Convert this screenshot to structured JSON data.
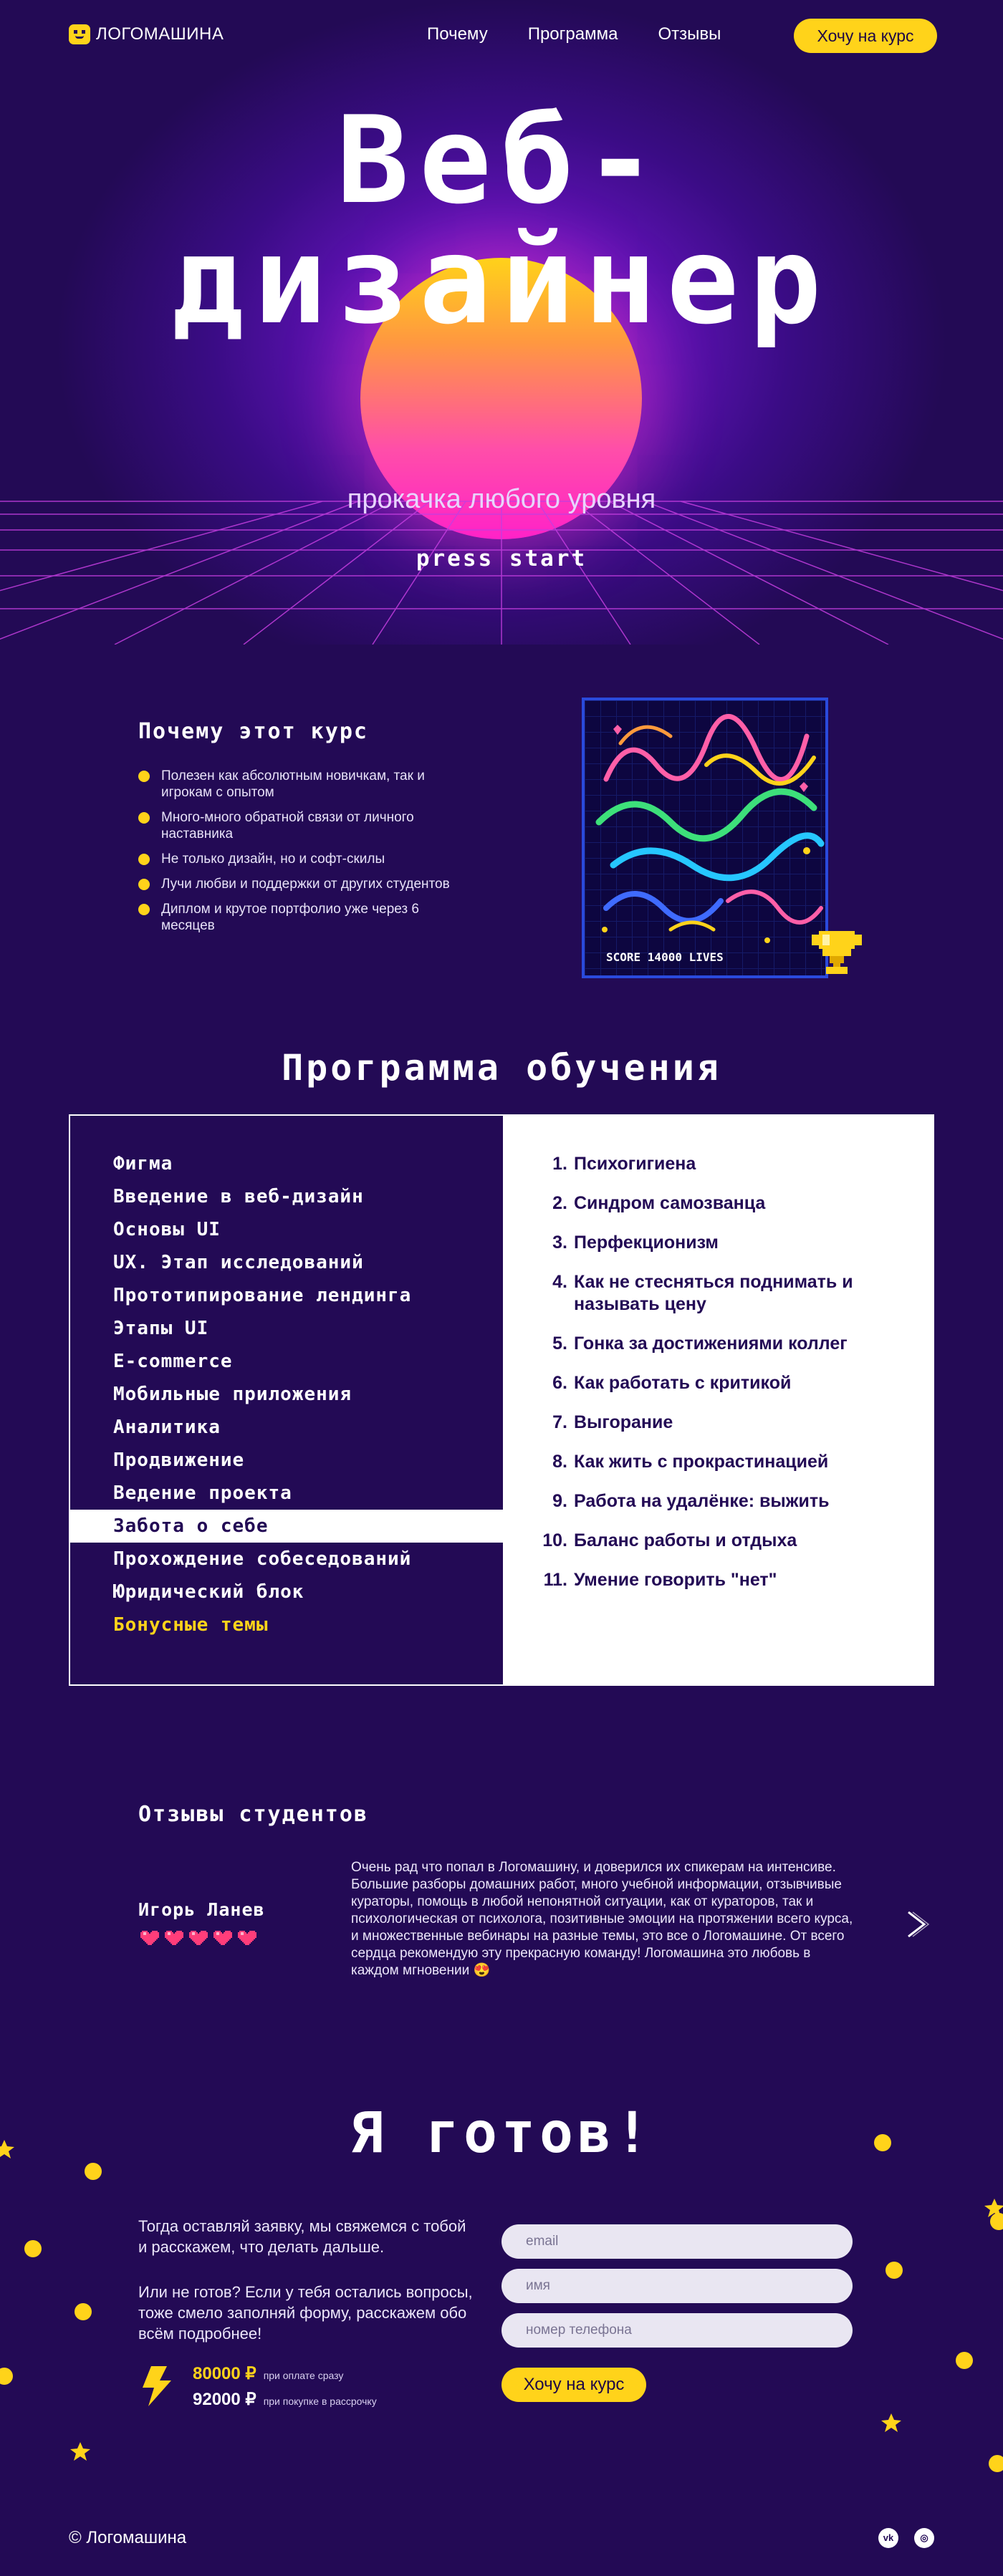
{
  "header": {
    "logo": "ЛОГОМАШИНА",
    "nav": [
      "Почему",
      "Программа",
      "Отзывы"
    ],
    "cta": "Хочу на курс"
  },
  "hero": {
    "title_line1": "Веб-",
    "title_line2": "дизайнер",
    "subtitle": "прокачка любого уровня",
    "press_start": "press start"
  },
  "why": {
    "title": "Почему этот курс",
    "items": [
      "Полезен как абсолютным новичкам, так и игрокам с опытом",
      "Много-много обратной связи от личного наставника",
      "Не только дизайн, но и софт-скилы",
      "Лучи любви и поддержки от других студентов",
      "Диплом и крутое портфолио уже через 6 месяцев"
    ],
    "poster_score": "SCORE 14000  LIVES"
  },
  "program": {
    "title": "Программа обучения",
    "modules": [
      "Фигма",
      "Введение в веб-дизайн",
      "Основы UI",
      "UX. Этап исследований",
      "Прототипирование лендинга",
      "Этапы UI",
      "E-commerce",
      "Мобильные приложения",
      "Аналитика",
      "Продвижение",
      "Ведение проекта",
      "Забота о себе",
      "Прохождение собеседований",
      "Юридический блок",
      "Бонусные темы"
    ],
    "active_module_index": 11,
    "topics": [
      {
        "num": "1.",
        "text": "Психогигиена"
      },
      {
        "num": "2.",
        "text": "Синдром самозванца"
      },
      {
        "num": "3.",
        "text": "Перфекционизм"
      },
      {
        "num": "4.",
        "text": "Как не стесняться поднимать и называть цену"
      },
      {
        "num": "5.",
        "text": "Гонка за достижениями коллег"
      },
      {
        "num": "6.",
        "text": "Как работать с критикой"
      },
      {
        "num": "7.",
        "text": "Выгорание"
      },
      {
        "num": "8.",
        "text": "Как жить с прокрастинацией"
      },
      {
        "num": "9.",
        "text": "Работа на удалёнке: выжить"
      },
      {
        "num": "10.",
        "text": "Баланс работы и отдыха"
      },
      {
        "num": "11.",
        "text": "Умение говорить \"нет\""
      }
    ]
  },
  "reviews": {
    "title": "Отзывы студентов",
    "name": "Игорь Ланев",
    "rating": 5,
    "text": "Очень рад что попал в Логомашину, и доверился их спикерам на интенсиве. Большие разборы домашних работ, много учебной информации, отзывчивые кураторы, помощь в любой непонятной ситуации, как от кураторов, так и психологическая от психолога, позитивные эмоции на протяжении всего курса, и множественные вебинары на разные темы, это все о Логомашине. От всего сердца рекомендую эту прекрасную команду! Логомашина это любовь в каждом мгновении 😍"
  },
  "ready": {
    "title": "Я готов!",
    "p1": "Тогда оставляй заявку, мы свяжемся с тобой и расскажем, что делать дальше.",
    "p2": "Или не готов? Если у тебя остались вопросы, тоже смело заполняй форму, расскажем обо всём подробнее!",
    "price1": "80000 ₽",
    "price1_note": "при оплате сразу",
    "price2": "92000 ₽",
    "price2_note": "при покупке в рассрочку",
    "fields": {
      "email": "email",
      "name": "имя",
      "phone": "номер телефона"
    },
    "cta": "Хочу на курс"
  },
  "footer": {
    "copyright": "© Логомашина",
    "social": [
      "vk",
      "instagram"
    ]
  },
  "colors": {
    "background": "#230a55",
    "accent": "#ffd31a",
    "sun_top": "#ffd21a",
    "sun_bottom": "#ff22c8"
  }
}
